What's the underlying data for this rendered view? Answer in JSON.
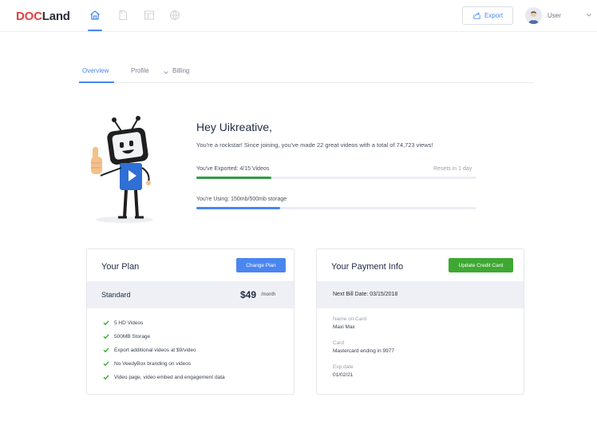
{
  "header": {
    "logo_part1": "DOC",
    "logo_part2": "Land",
    "export_label": "Export",
    "user_label": "User"
  },
  "nav_icons": [
    "home-icon",
    "tag-icon",
    "layout-icon",
    "globe-icon"
  ],
  "tabs": [
    {
      "label": "Overview",
      "active": true
    },
    {
      "label": "Profile",
      "active": false
    },
    {
      "label": "Billing",
      "active": false
    }
  ],
  "hero": {
    "greeting": "Hey Uikreative,",
    "subtitle": "You're a rockstar! Since joining, you've made 22 great videos with a total of 74,723 views!",
    "export_label": "You've Exported: 4/15 Videos",
    "export_resets": "Resets in 1 day",
    "export_progress": 0.267,
    "storage_label": "You're Using: 150mb/500mb storage",
    "storage_progress": 0.3
  },
  "plan_card": {
    "title": "Your Plan",
    "button_label": "Change Plan",
    "plan_name": "Standard",
    "price": "$49",
    "period": "/month",
    "features": [
      "5 HD Videos",
      "500MB Storage",
      "Export additional videos at $9/video",
      "No VeedyBox branding on videos",
      "Video page, video embed and engagement data"
    ]
  },
  "payment_card": {
    "title": "Your Payment Info",
    "button_label": "Update Credit Card",
    "bill_date": "Next Bill Date: 03/15/2018",
    "fields": [
      {
        "label": "Name on Card",
        "value": "Maxi Max"
      },
      {
        "label": "Card",
        "value": "Mastercard ending in 9977"
      },
      {
        "label": "Exp date",
        "value": "01/02/21"
      }
    ]
  },
  "colors": {
    "accent": "#4a86f0",
    "brand_red": "#e3413f",
    "success": "#3ea832",
    "export_bar": "#2f9e44"
  }
}
